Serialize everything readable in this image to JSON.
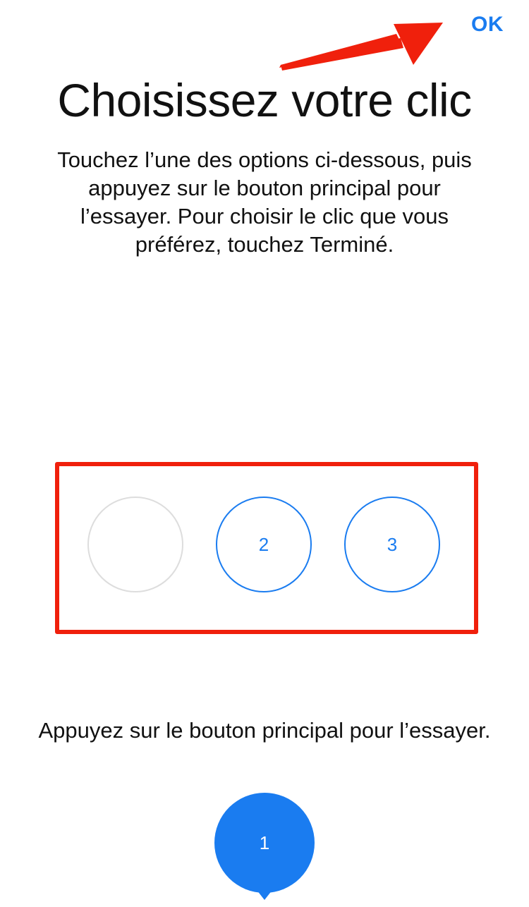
{
  "header": {
    "ok_label": "OK"
  },
  "title": "Choisissez votre clic",
  "instructions": "Touchez l’une des options ci-dessous, puis appuyez sur le bouton principal pour l’essayer. Pour choisir le clic que vous préférez, touchez Terminé.",
  "options": [
    {
      "label": "",
      "selected": true
    },
    {
      "label": "2",
      "selected": false
    },
    {
      "label": "3",
      "selected": false
    }
  ],
  "press_hint": "Appuyez sur le bouton principal pour l’essayer.",
  "main_button": {
    "label": "1"
  },
  "colors": {
    "accent": "#1a7cf0",
    "annotation": "#f0200c",
    "selected_border": "#dddddd"
  }
}
